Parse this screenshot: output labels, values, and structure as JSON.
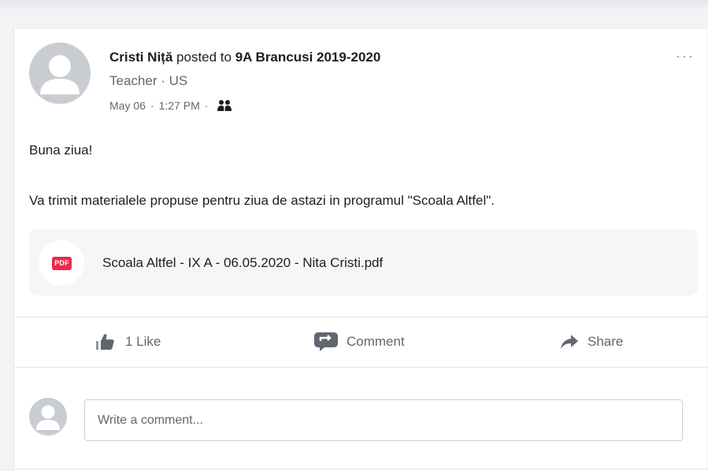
{
  "post": {
    "author": "Cristi Niță",
    "posted_to": "posted to",
    "group": "9A Brancusi 2019-2020",
    "author_subtitle": "Teacher · US",
    "date": "May 06",
    "time": "1:27 PM",
    "separator": "·",
    "audience_icon": "group-members-icon",
    "more_label": "···",
    "greeting": "Buna ziua!",
    "message": "Va trimit materialele propuse pentru ziua de astazi in programul \"Scoala Altfel\"."
  },
  "attachment": {
    "badge": "PDF",
    "filename": "Scoala Altfel - IX A - 06.05.2020 - Nita Cristi.pdf",
    "badge_color": "#f02849"
  },
  "actions": {
    "like_label": "1 Like",
    "comment_label": "Comment",
    "share_label": "Share"
  },
  "comment_box": {
    "placeholder": "Write a comment..."
  },
  "colors": {
    "text": "#1c1e21",
    "secondary": "#606770",
    "icon": "#8d949e",
    "avatar_bg": "#c9ccd1"
  }
}
